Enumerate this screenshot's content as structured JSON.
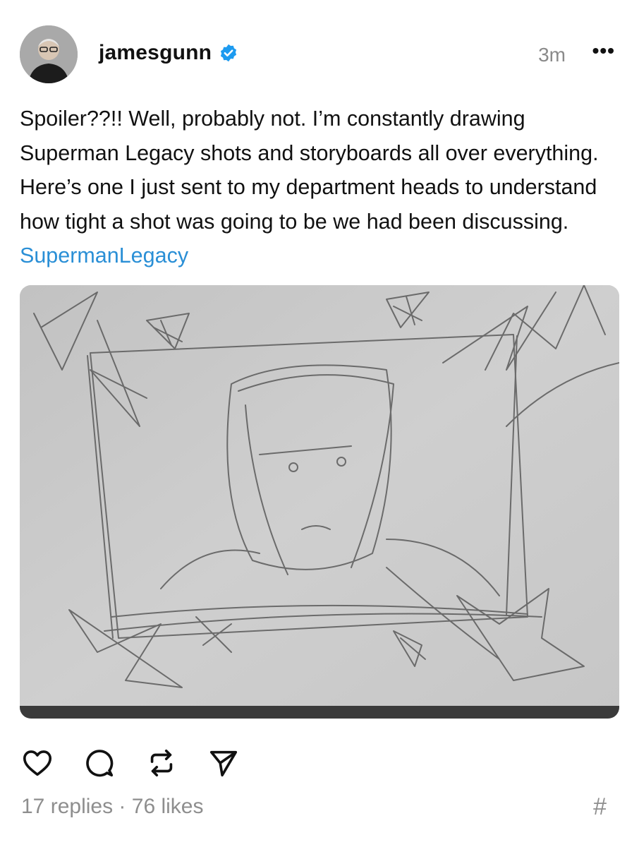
{
  "post": {
    "username": "jamesgunn",
    "timestamp": "3m",
    "more_label": "•••",
    "text": "Spoiler??!! Well, probably not. I’m constantly drawing Superman Legacy shots and storyboards all over everything. Here’s one I just sent to my department heads to understand how tight a shot was going to be we had been discussing.",
    "hashtag": "SupermanLegacy"
  },
  "stats": {
    "replies": "17 replies",
    "separator": "·",
    "likes": "76 likes",
    "hash_symbol": "#"
  },
  "icons": {
    "verified": "verified-badge-icon",
    "like": "heart-icon",
    "reply": "comment-bubble-icon",
    "repost": "repost-icon",
    "share": "send-icon"
  },
  "colors": {
    "hashtag": "#2a8fd6",
    "verified": "#1d9bf0",
    "muted": "#8e8e8e"
  }
}
